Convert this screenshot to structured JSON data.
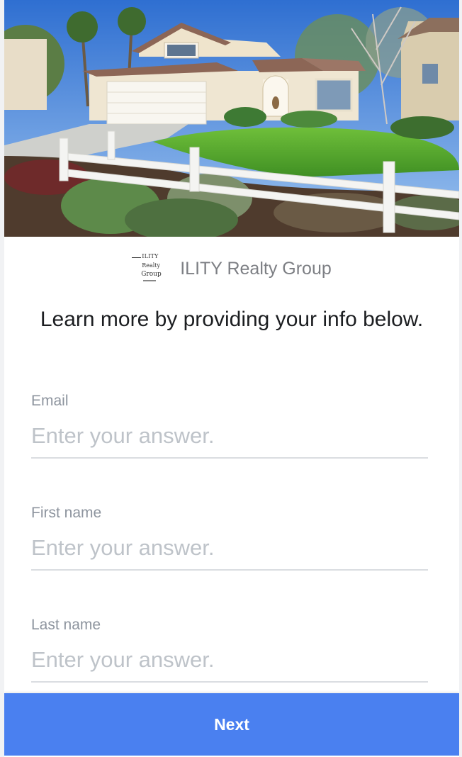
{
  "brand": {
    "logo_lines": [
      "ILITY",
      "Realty",
      "Group"
    ],
    "name": "ILITY Realty Group"
  },
  "headline": "Learn more by providing your info below.",
  "form": {
    "fields": [
      {
        "label": "Email",
        "placeholder": "Enter your answer.",
        "value": ""
      },
      {
        "label": "First name",
        "placeholder": "Enter your answer.",
        "value": ""
      },
      {
        "label": "Last name",
        "placeholder": "Enter your answer.",
        "value": ""
      }
    ]
  },
  "actions": {
    "next_label": "Next"
  },
  "colors": {
    "primary": "#4a80f0",
    "label": "#8d949e",
    "placeholder": "#bec3c9"
  }
}
